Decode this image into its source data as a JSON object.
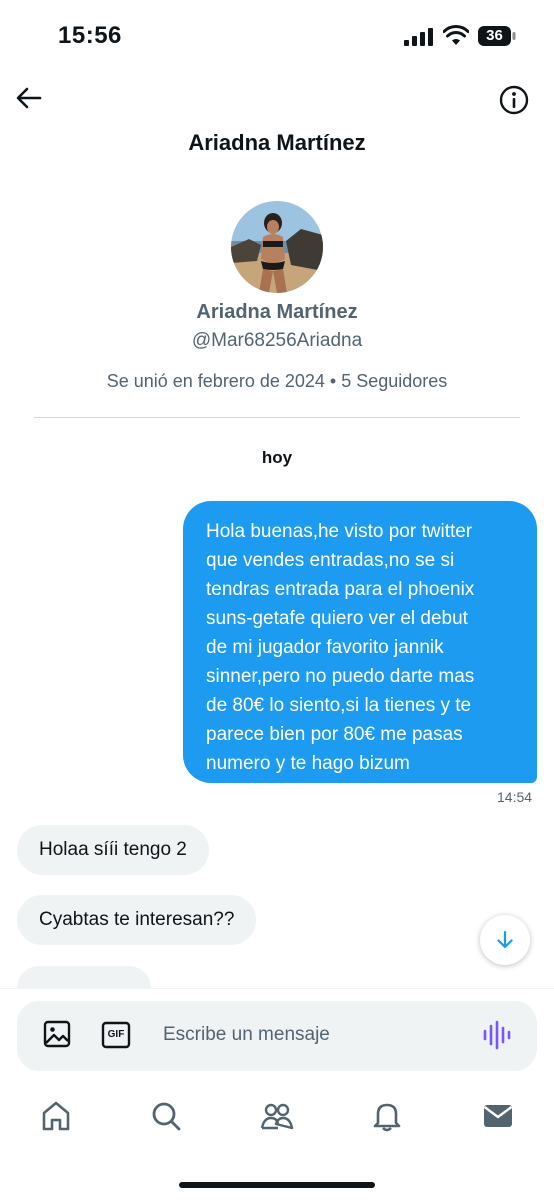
{
  "status_bar": {
    "time": "15:56",
    "battery": "36"
  },
  "header": {
    "title": "Ariadna Martínez"
  },
  "profile": {
    "name": "Ariadna Martínez",
    "handle": "@Mar68256Ariadna",
    "meta": "Se unió en febrero de 2024 • 5 Seguidores"
  },
  "conversation": {
    "day_label": "hoy",
    "sent_message": {
      "lines": [
        "Hola buenas,he visto por twitter",
        "que vendes entradas,no se si",
        "tendras entrada para el phoenix",
        "suns-getafe quiero ver el debut",
        "de mi jugador favorito jannik",
        "sinner,pero no puedo darte mas",
        "de 80€ lo siento,si la tienes y te",
        "parece bien por 80€ me pasas",
        "numero y te hago bizum"
      ],
      "time": "14:54"
    },
    "received": [
      {
        "text": "Holaa sííi tengo 2"
      },
      {
        "text": "Cyabtas te interesan??"
      }
    ]
  },
  "composer": {
    "placeholder": "Escribe un mensaje",
    "gif_label": "GIF"
  },
  "icons": {
    "back": "back-arrow-icon",
    "info": "info-icon",
    "image": "image-icon",
    "gif": "gif-icon",
    "voice": "voice-wave-icon",
    "scroll": "arrow-down-icon",
    "tabs": [
      "home-icon",
      "search-icon",
      "communities-icon",
      "notifications-icon",
      "messages-icon"
    ]
  },
  "colors": {
    "accent": "#1d9bf0",
    "voice": "#7856ff",
    "bubble_received": "#eff3f4",
    "muted": "#536471"
  }
}
